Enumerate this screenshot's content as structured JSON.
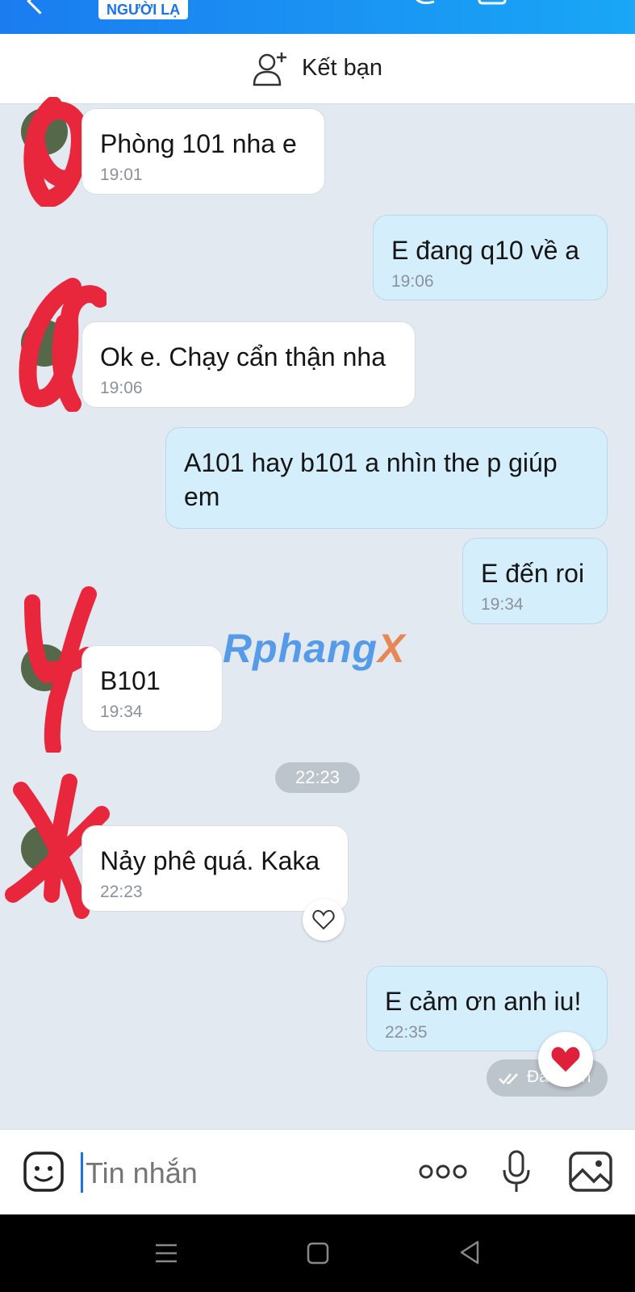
{
  "header": {
    "stranger_badge": "NGƯỜI LẠ"
  },
  "add_friend": {
    "label": "Kết bạn"
  },
  "messages": [
    {
      "side": "in",
      "text": "Phòng 101 nha e",
      "time": "19:01"
    },
    {
      "side": "out",
      "text": "E đang q10 về a",
      "time": "19:06"
    },
    {
      "side": "in",
      "text": "Ok e. Chạy cẩn thận nha",
      "time": "19:06"
    },
    {
      "side": "out",
      "text": "A101 hay b101 a nhìn the p giúp em",
      "time": ""
    },
    {
      "side": "out",
      "text": "E đến roi",
      "time": "19:34"
    },
    {
      "side": "in",
      "text": "B101",
      "time": "19:34"
    },
    {
      "side": "in",
      "text": "Nảy phê quá. Kaka",
      "time": "22:23"
    },
    {
      "side": "out",
      "text": "E cảm ơn anh iu!",
      "time": "22:35"
    }
  ],
  "divider_time": "22:23",
  "status": {
    "received": "Đã nhận"
  },
  "watermark": {
    "main": "Rphang",
    "accent": "X"
  },
  "input": {
    "placeholder": "Tin nhắn"
  },
  "colors": {
    "header_start": "#1a7cf0",
    "header_end": "#19a7f6",
    "incoming_bubble": "#ffffff",
    "outgoing_bubble": "#d5eefc",
    "chat_background": "#e2e9f1"
  }
}
